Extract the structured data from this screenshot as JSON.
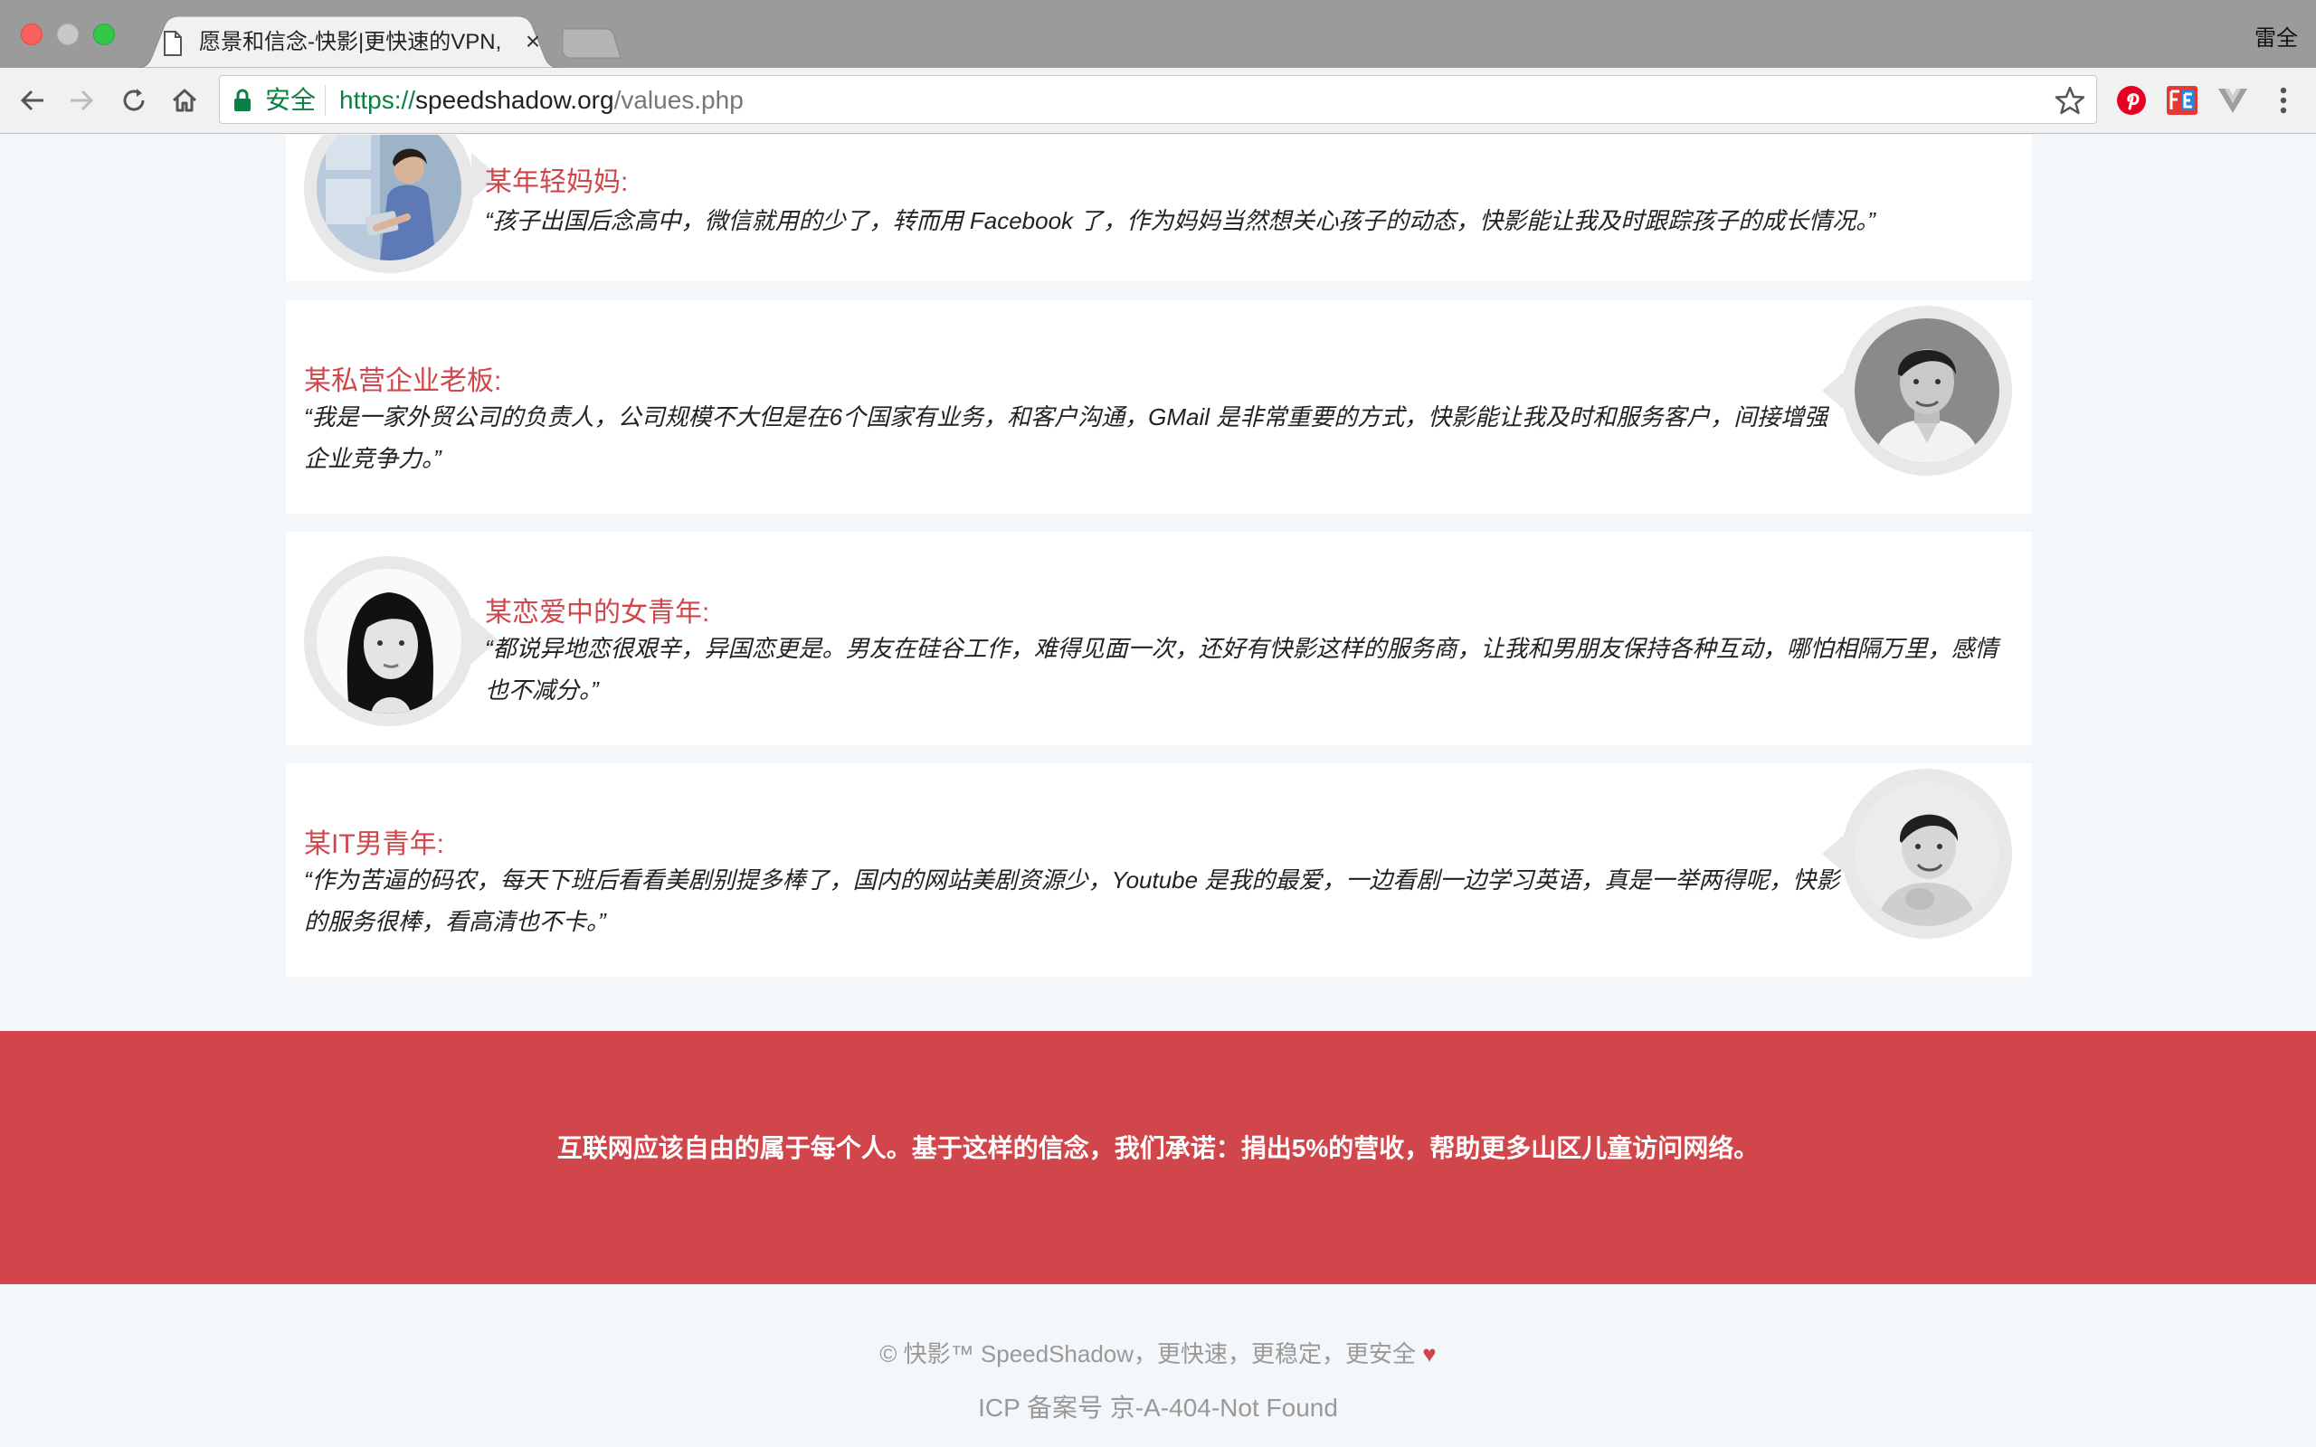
{
  "browser": {
    "tab_title": "愿景和信念-快影|更快速的VPN,",
    "tab_close_glyph": "×",
    "profile_name": "雷全",
    "secure_label": "安全",
    "url_scheme": "https://",
    "url_host": "speedshadow.org",
    "url_path": "/values.php",
    "icons": {
      "back": "back-arrow-icon",
      "forward": "forward-arrow-icon",
      "reload": "reload-icon",
      "home": "home-icon",
      "lock": "lock-icon",
      "bookmark": "star-icon",
      "ext1": "pinterest-icon",
      "ext2": "fe-icon",
      "ext3": "vue-icon",
      "menu": "kebab-menu-icon"
    }
  },
  "testimonials": [
    {
      "who": "某年轻妈妈:",
      "quote": "“孩子出国后念高中，微信就用的少了，转而用 Facebook 了，作为妈妈当然想关心孩子的动态，快影能让我及时跟踪孩子的成长情况。”"
    },
    {
      "who": "某私营企业老板:",
      "quote": "“我是一家外贸公司的负责人，公司规模不大但是在6个国家有业务，和客户沟通，GMail 是非常重要的方式，快影能让我及时和服务客户，间接增强企业竞争力。”"
    },
    {
      "who": "某恋爱中的女青年:",
      "quote": "“都说异地恋很艰辛，异国恋更是。男友在硅谷工作，难得见面一次，还好有快影这样的服务商，让我和男朋友保持各种互动，哪怕相隔万里，感情也不减分。”"
    },
    {
      "who": "某IT男青年:",
      "quote": "“作为苦逼的码农，每天下班后看看美剧别提多棒了，国内的网站美剧资源少，Youtube 是我的最爱，一边看剧一边学习英语，真是一举两得呢，快影的服务很棒，看高清也不卡。”"
    }
  ],
  "banner": {
    "text": "互联网应该自由的属于每个人。基于这样的信念，我们承诺：捐出5%的营收，帮助更多山区儿童访问网络。"
  },
  "footer": {
    "copyright": "© 快影™ SpeedShadow，更快速，更稳定，更安全",
    "heart": "♥",
    "icp": "ICP 备案号 京-A-404-Not Found"
  },
  "colors": {
    "accent": "#d0464b",
    "page_bg": "#f4f7f9",
    "card_bg": "#ffffff",
    "secure_green": "#0b8043"
  }
}
